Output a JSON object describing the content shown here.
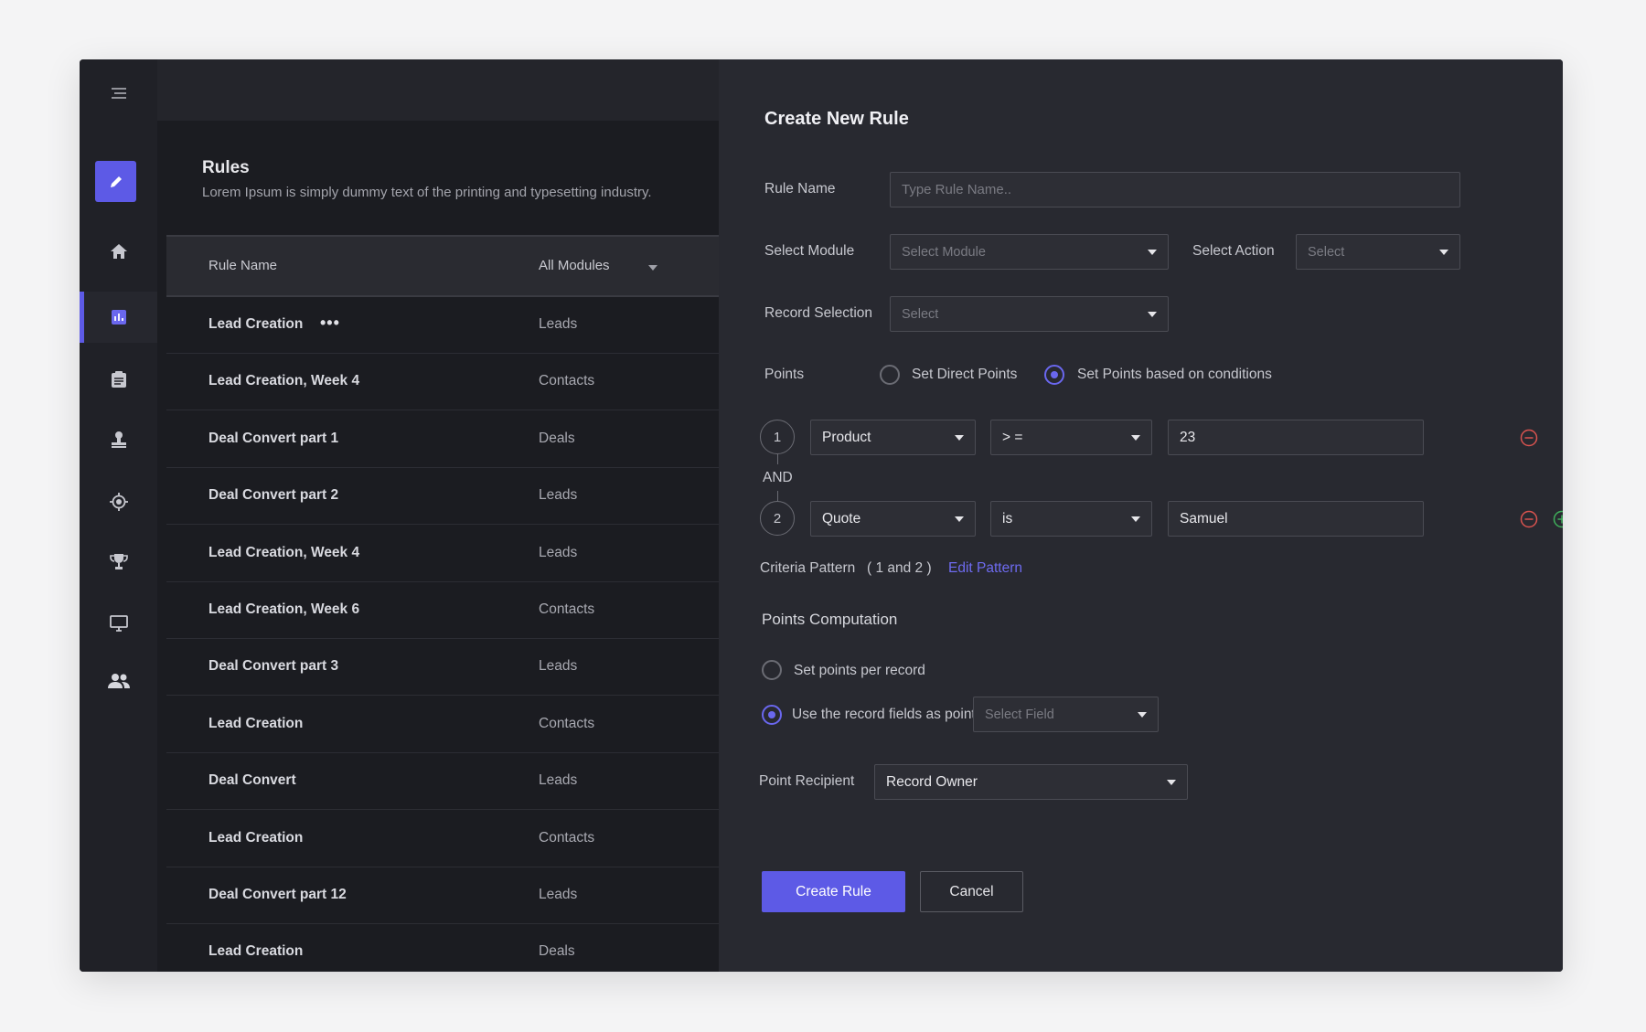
{
  "sidebar": {
    "icons": [
      "menu-icon",
      "edit-icon",
      "home-icon",
      "chart-icon",
      "clipboard-icon",
      "stamp-icon",
      "target-icon",
      "trophy-icon",
      "monitor-icon",
      "users-icon"
    ],
    "accent": "#5d5ae6"
  },
  "rules": {
    "title": "Rules",
    "subtitle": "Lorem Ipsum is simply dummy text of the printing and typesetting industry.",
    "columns": {
      "name": "Rule Name",
      "module": "All Modules"
    },
    "rows": [
      {
        "name": "Lead Creation",
        "module": "Leads",
        "more": "•••"
      },
      {
        "name": "Lead Creation, Week 4",
        "module": "Contacts"
      },
      {
        "name": "Deal Convert part 1",
        "module": "Deals"
      },
      {
        "name": "Deal Convert part 2",
        "module": "Leads"
      },
      {
        "name": "Lead Creation, Week 4",
        "module": "Leads"
      },
      {
        "name": "Lead Creation, Week 6",
        "module": "Contacts"
      },
      {
        "name": "Deal Convert part 3",
        "module": "Leads"
      },
      {
        "name": "Lead Creation",
        "module": "Contacts"
      },
      {
        "name": "Deal Convert",
        "module": "Leads"
      },
      {
        "name": "Lead Creation",
        "module": "Contacts"
      },
      {
        "name": "Deal Convert part 12",
        "module": "Leads"
      },
      {
        "name": "Lead Creation",
        "module": "Deals"
      }
    ]
  },
  "form": {
    "title": "Create New Rule",
    "rule_name": {
      "label": "Rule Name",
      "placeholder": "Type Rule Name.."
    },
    "module": {
      "label": "Select Module",
      "value": "Select Module"
    },
    "action": {
      "label": "Select Action",
      "value": "Select"
    },
    "record_selection": {
      "label": "Record Selection",
      "value": "Select"
    },
    "points": {
      "label": "Points",
      "options": [
        "Set Direct Points",
        "Set Points based on conditions"
      ],
      "selected": 1
    },
    "conditions": [
      {
        "num": "1",
        "field": "Product",
        "operator": "> =",
        "value": "23"
      },
      {
        "num": "2",
        "field": "Quote",
        "operator": "is",
        "value": "Samuel"
      }
    ],
    "conjunction": "AND",
    "criteria": {
      "label": "Criteria Pattern",
      "pattern": "( 1 and 2 )",
      "edit_label": "Edit Pattern"
    },
    "computation": {
      "title": "Points Computation",
      "options": [
        "Set points per record",
        "Use the record fields as points"
      ],
      "selected": 1,
      "field_select": "Select Field"
    },
    "recipient": {
      "label": "Point Recipient",
      "value": "Record Owner"
    },
    "create_label": "Create Rule",
    "cancel_label": "Cancel"
  }
}
